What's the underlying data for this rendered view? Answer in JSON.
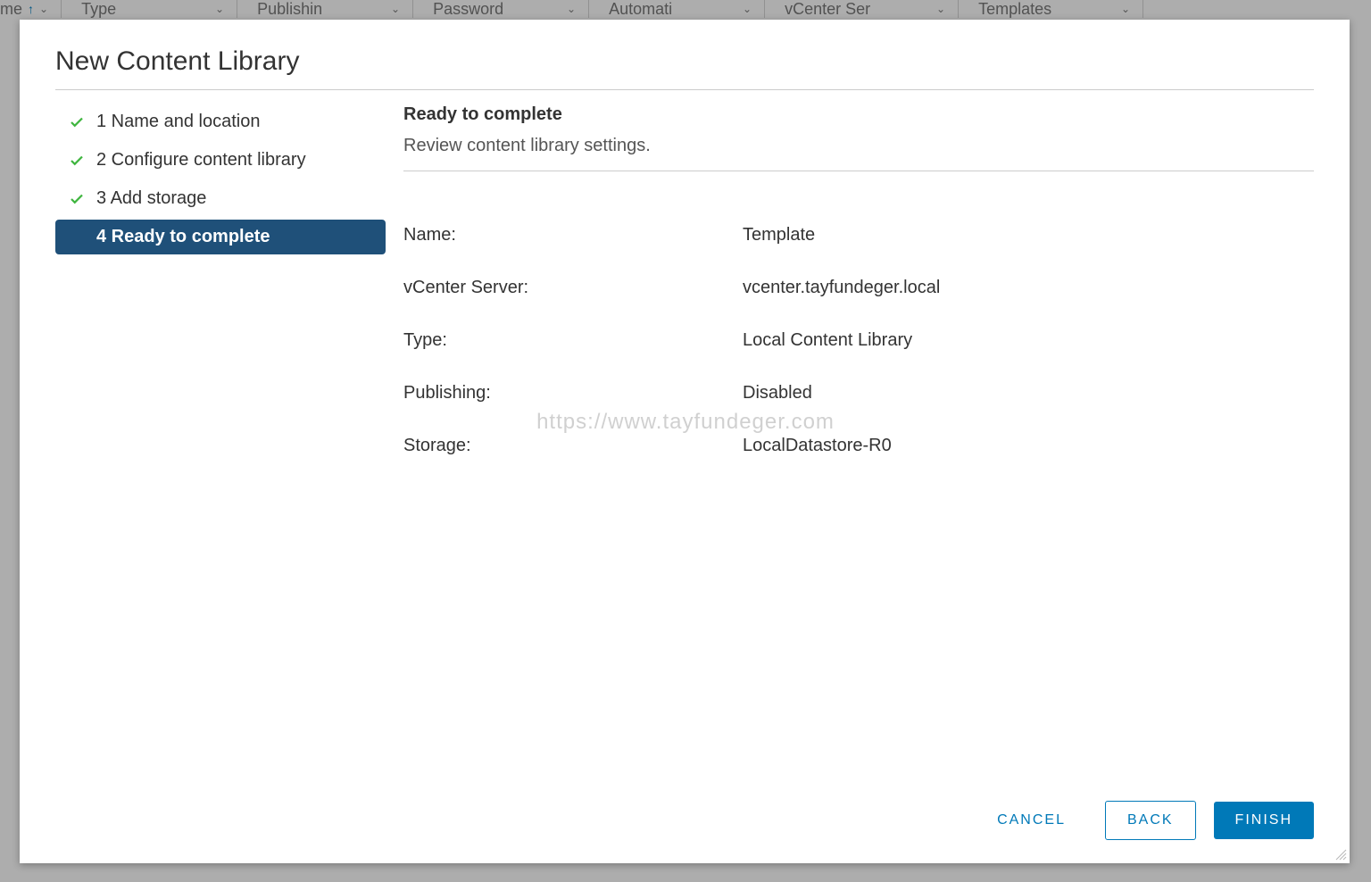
{
  "background": {
    "columns": [
      {
        "label": "me",
        "sort": true
      },
      {
        "label": "Type"
      },
      {
        "label": "Publishin"
      },
      {
        "label": "Password"
      },
      {
        "label": "Automati"
      },
      {
        "label": "vCenter Ser"
      },
      {
        "label": "Templates"
      }
    ]
  },
  "modal": {
    "title": "New Content Library",
    "steps": [
      {
        "label": "1 Name and location",
        "completed": true,
        "active": false
      },
      {
        "label": "2 Configure content library",
        "completed": true,
        "active": false
      },
      {
        "label": "3 Add storage",
        "completed": true,
        "active": false
      },
      {
        "label": "4 Ready to complete",
        "completed": false,
        "active": true
      }
    ],
    "content": {
      "heading": "Ready to complete",
      "subheading": "Review content library settings.",
      "rows": [
        {
          "key": "Name:",
          "value": "Template"
        },
        {
          "key": "vCenter Server:",
          "value": "vcenter.tayfundeger.local"
        },
        {
          "key": "Type:",
          "value": "Local Content Library"
        },
        {
          "key": "Publishing:",
          "value": "Disabled"
        },
        {
          "key": "Storage:",
          "value": "LocalDatastore-R0"
        }
      ]
    },
    "buttons": {
      "cancel": "CANCEL",
      "back": "BACK",
      "finish": "FINISH"
    }
  },
  "watermark": "https://www.tayfundeger.com"
}
